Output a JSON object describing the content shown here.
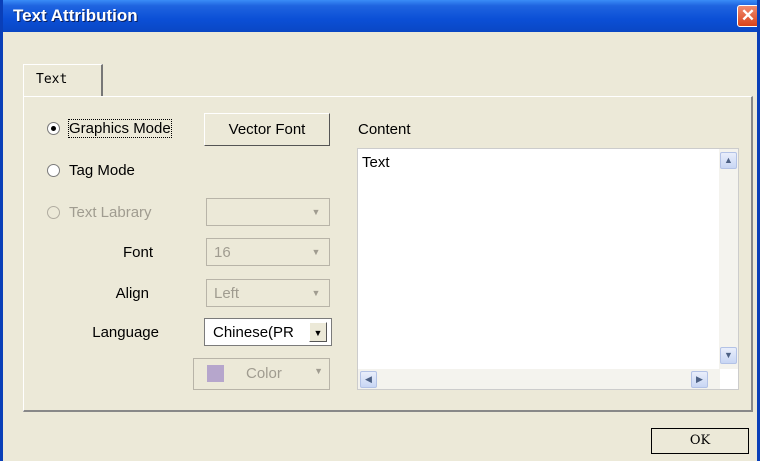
{
  "window": {
    "title": "Text Attribution",
    "close_glyph": "✕"
  },
  "tabs": [
    {
      "label": "Text"
    }
  ],
  "mode": {
    "graphics_label": "Graphics Mode",
    "tag_label": "Tag Mode",
    "library_label": "Text Labrary",
    "selected": "Graphics Mode"
  },
  "buttons": {
    "vector_font": "Vector Font",
    "color": "Color",
    "ok": "OK"
  },
  "fields": {
    "library": {
      "value": ""
    },
    "font": {
      "label": "Font",
      "value": "16"
    },
    "align": {
      "label": "Align",
      "value": "Left"
    },
    "language": {
      "label": "Language",
      "value": "Chinese(PR"
    }
  },
  "content": {
    "label": "Content",
    "text": "Text"
  },
  "icons": {
    "close": "close-icon",
    "dropdown": "chevron-down-icon",
    "scroll_up": "scroll-up-arrow-icon",
    "scroll_down": "scroll-down-arrow-icon",
    "scroll_left": "scroll-left-arrow-icon",
    "scroll_right": "scroll-right-arrow-icon",
    "down_glyph": "▼",
    "up_glyph": "▲",
    "left_glyph": "◀",
    "right_glyph": "▶"
  },
  "colors": {
    "title_bar": "#0a4fd6",
    "close_button": "#d9431c",
    "color_swatch": "#b6a6cc"
  }
}
